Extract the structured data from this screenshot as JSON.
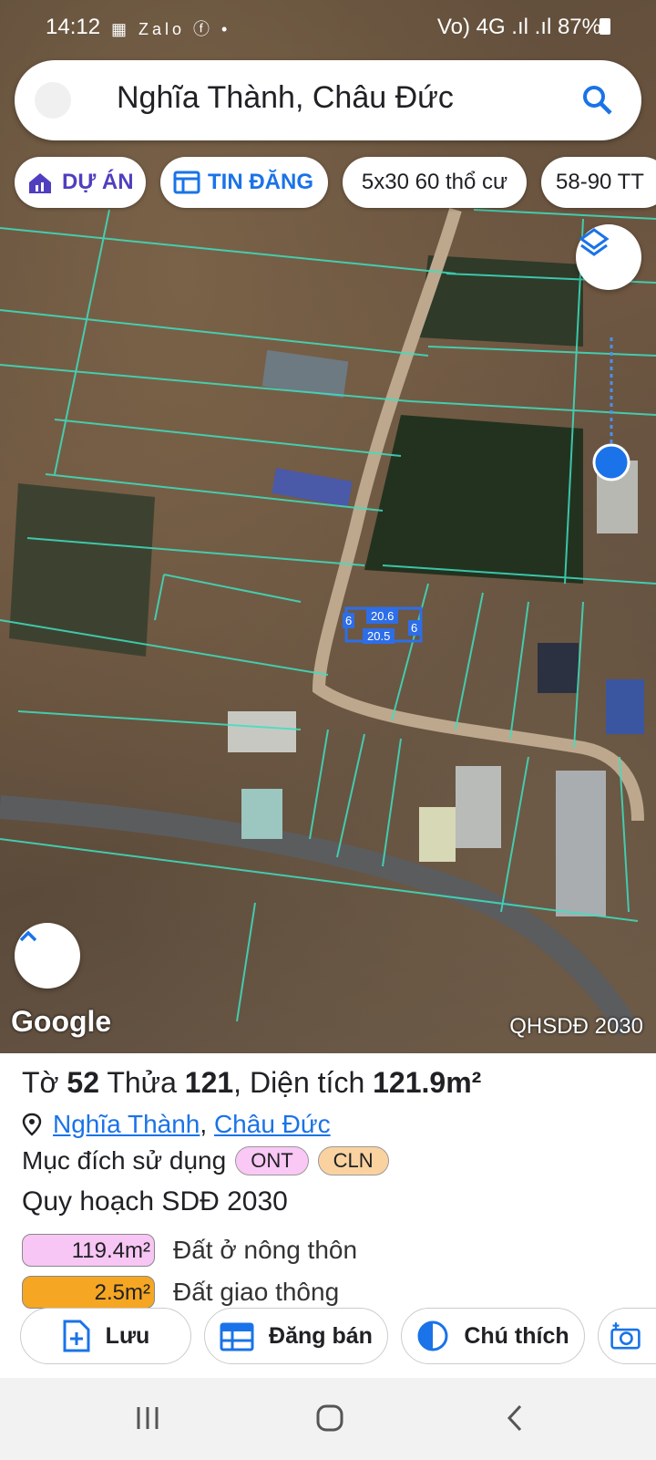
{
  "status_bar": {
    "time": "14:12",
    "left_icons": "▦ Zalo ⓕ •",
    "right_text": "Vo) 4G  .ıl .ıl 87%"
  },
  "search": {
    "query": "Nghĩa Thành, Châu Đức"
  },
  "chips": [
    {
      "label": "DỰ ÁN",
      "icon": "house-chart-icon"
    },
    {
      "label": "TIN ĐĂNG",
      "icon": "listing-icon"
    },
    {
      "label": "5x30 60 thổ cư"
    },
    {
      "label": "58-90 TT"
    }
  ],
  "map": {
    "parcel_labels": {
      "left": "6",
      "top": "20.6",
      "bottom": "20.5",
      "right": "6"
    },
    "attribution": "Google",
    "layer_label": "QHSDĐ 2030"
  },
  "sheet": {
    "title_prefix": "Tờ",
    "sheet_no": "52",
    "plot_prefix": "Thửa",
    "plot_no": "121",
    "area_prefix": ", Diện tích",
    "area_value": "121.9m²",
    "location_1": "Nghĩa Thành",
    "location_sep": ",",
    "location_2": "Châu Đức",
    "purpose_label": "Mục đích sử dụng",
    "purpose_tags": [
      "ONT",
      "CLN"
    ],
    "plan_label": "Quy hoạch SDĐ 2030",
    "plan_items": [
      {
        "area": "119.4m²",
        "label": "Đất ở nông thôn",
        "color": "#f7c6f4"
      },
      {
        "area": "2.5m²",
        "label": "Đất giao thông",
        "color": "#f5a623"
      }
    ]
  },
  "actions": [
    {
      "label": "Lưu",
      "icon": "file-add-icon"
    },
    {
      "label": "Đăng bán",
      "icon": "calendar-icon"
    },
    {
      "label": "Chú thích",
      "icon": "contrast-icon"
    },
    {
      "label": "",
      "icon": "add-photo-icon"
    }
  ],
  "colors": {
    "accent": "#1a73e8",
    "parcel_line": "#3ee0c0",
    "ont_tag": "#f9c8f5",
    "cln_tag": "#fad2a0"
  }
}
